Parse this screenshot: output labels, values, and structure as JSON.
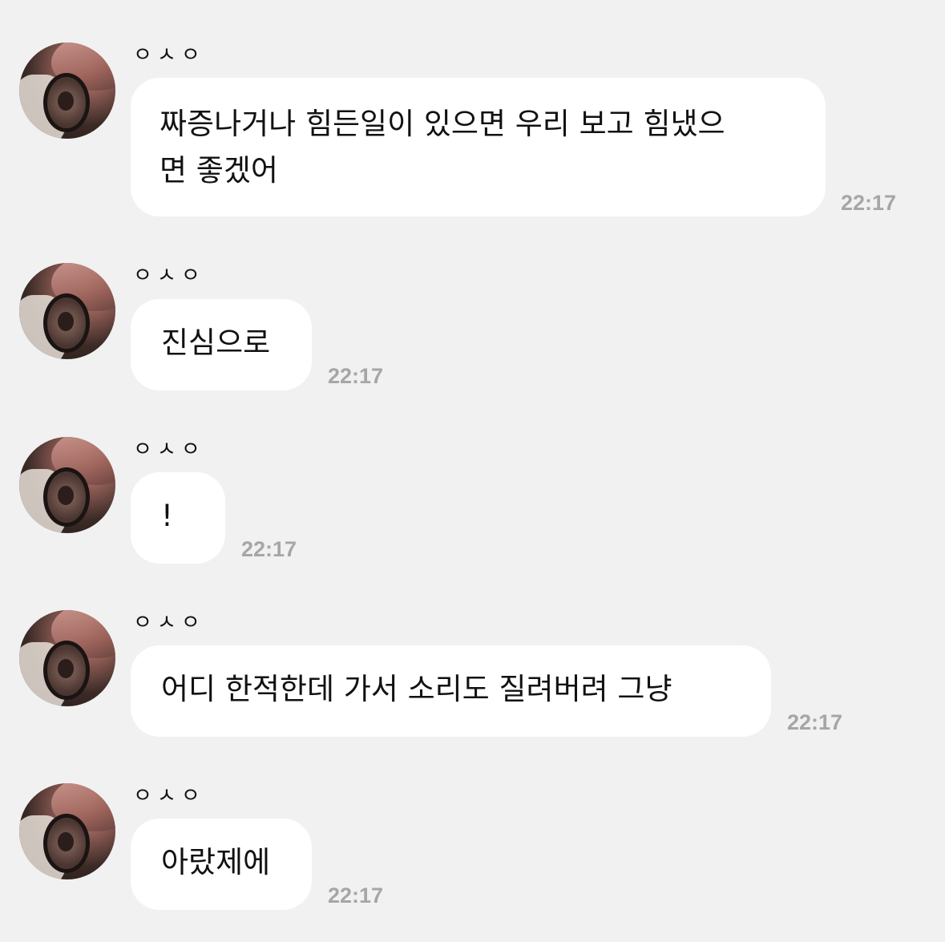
{
  "messages": [
    {
      "sender": "ㅇㅅㅇ",
      "text": "짜증나거나 힘든일이 있으면 우리 보고 힘냈으\n면 좋겠어",
      "time": "22:17"
    },
    {
      "sender": "ㅇㅅㅇ",
      "text": "진심으로",
      "time": "22:17"
    },
    {
      "sender": "ㅇㅅㅇ",
      "text": "!",
      "time": "22:17"
    },
    {
      "sender": "ㅇㅅㅇ",
      "text": "어디 한적한데 가서 소리도 질려버려 그냥",
      "time": "22:17"
    },
    {
      "sender": "ㅇㅅㅇ",
      "text": "아랐제에",
      "time": "22:17"
    }
  ],
  "colors": {
    "background": "#f1f1f1",
    "bubble": "#ffffff",
    "text": "#111111",
    "time": "#a6a6a6"
  }
}
